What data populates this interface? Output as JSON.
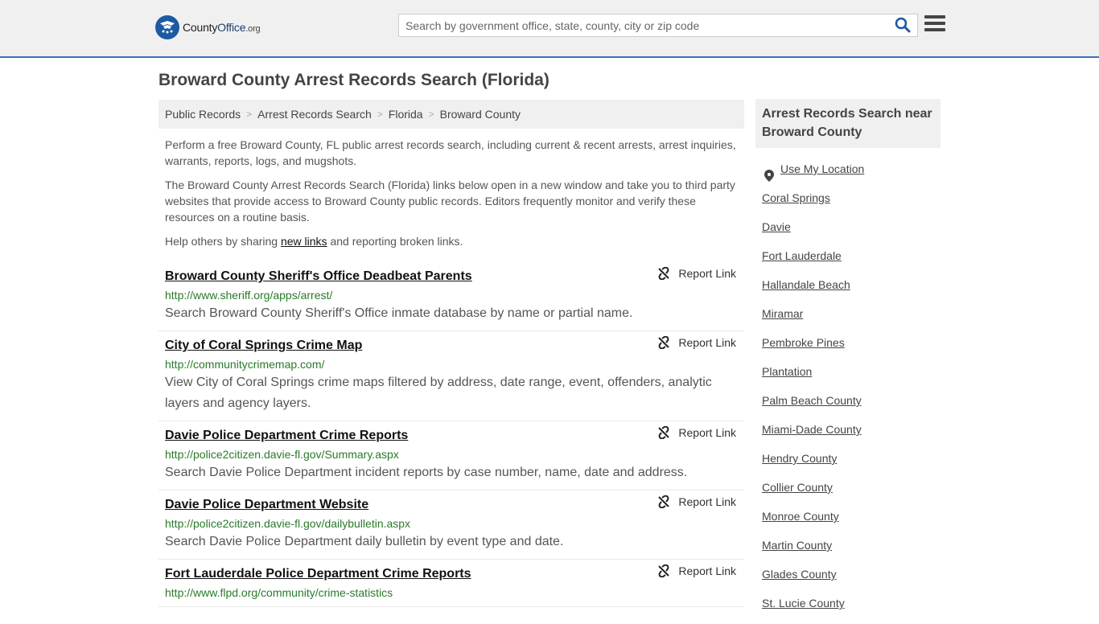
{
  "header": {
    "logo_county": "County",
    "logo_office": "Office",
    "logo_org": ".org",
    "search_placeholder": "Search by government office, state, county, city or zip code"
  },
  "page": {
    "title": "Broward County Arrest Records Search (Florida)"
  },
  "breadcrumb": [
    "Public Records",
    "Arrest Records Search",
    "Florida",
    "Broward County"
  ],
  "intro": {
    "p1": "Perform a free Broward County, FL public arrest records search, including current & recent arrests, arrest inquiries, warrants, reports, logs, and mugshots.",
    "p2": "The Broward County Arrest Records Search (Florida) links below open in a new window and take you to third party websites that provide access to Broward County public records. Editors frequently monitor and verify these resources on a routine basis.",
    "p3_before": "Help others by sharing ",
    "p3_link": "new links",
    "p3_after": " and reporting broken links."
  },
  "report_label": "Report Link",
  "results": [
    {
      "title": "Broward County Sheriff's Office Deadbeat Parents",
      "url": "http://www.sheriff.org/apps/arrest/",
      "desc": "Search Broward County Sheriff's Office inmate database by name or partial name."
    },
    {
      "title": "City of Coral Springs Crime Map",
      "url": "http://communitycrimemap.com/",
      "desc": "View City of Coral Springs crime maps filtered by address, date range, event, offenders, analytic layers and agency layers."
    },
    {
      "title": "Davie Police Department Crime Reports",
      "url": "http://police2citizen.davie-fl.gov/Summary.aspx",
      "desc": "Search Davie Police Department incident reports by case number, name, date and address."
    },
    {
      "title": "Davie Police Department Website",
      "url": "http://police2citizen.davie-fl.gov/dailybulletin.aspx",
      "desc": "Search Davie Police Department daily bulletin by event type and date."
    },
    {
      "title": "Fort Lauderdale Police Department Crime Reports",
      "url": "http://www.flpd.org/community/crime-statistics",
      "desc": ""
    }
  ],
  "sidebar": {
    "heading": "Arrest Records Search near Broward County",
    "use_location": "Use My Location",
    "links": [
      "Coral Springs",
      "Davie",
      "Fort Lauderdale",
      "Hallandale Beach",
      "Miramar",
      "Pembroke Pines",
      "Plantation",
      "Palm Beach County",
      "Miami-Dade County",
      "Hendry County",
      "Collier County",
      "Monroe County",
      "Martin County",
      "Glades County",
      "St. Lucie County"
    ]
  }
}
